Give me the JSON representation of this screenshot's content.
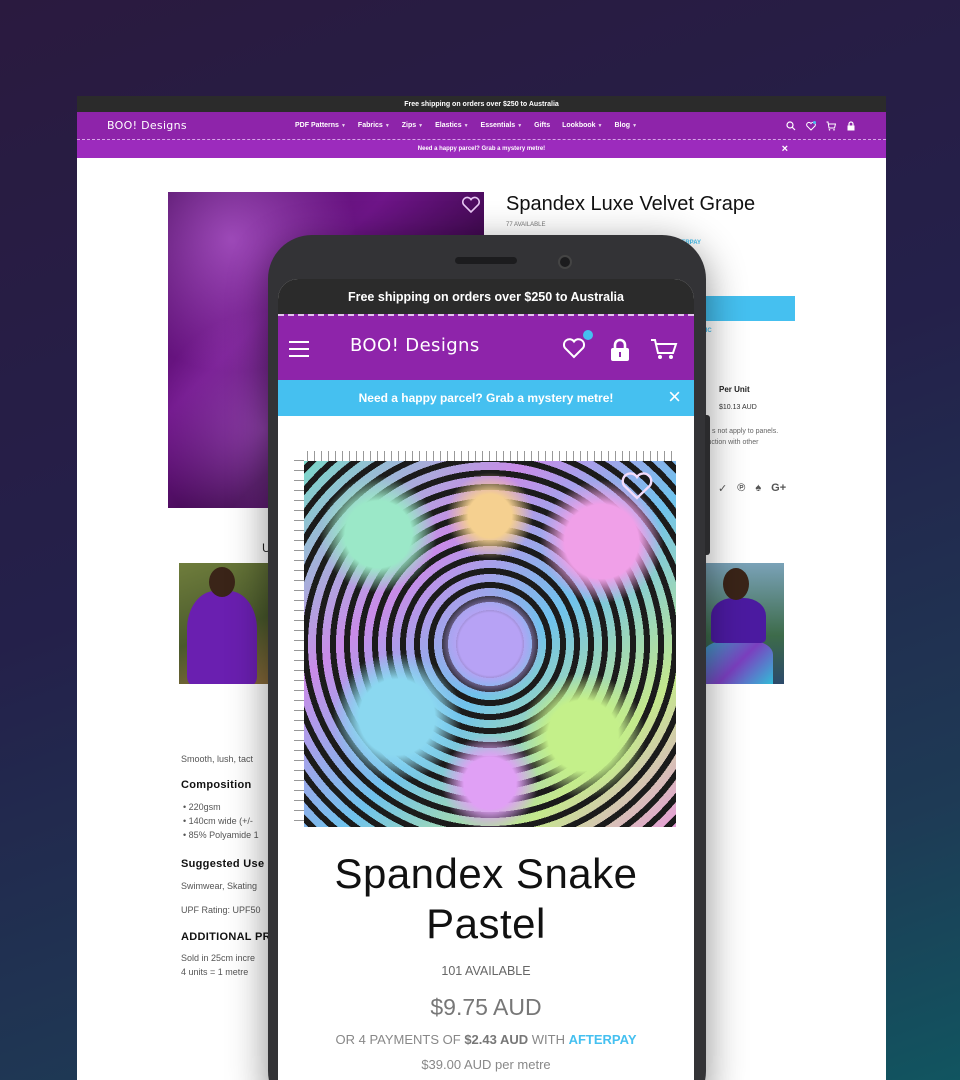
{
  "desktop": {
    "shipping_banner": "Free shipping on orders over $250 to Australia",
    "logo": "BOO! Designs",
    "menu": [
      {
        "label": "PDF Patterns",
        "chevron": true
      },
      {
        "label": "Fabrics",
        "chevron": true
      },
      {
        "label": "Zips",
        "chevron": true
      },
      {
        "label": "Elastics",
        "chevron": true
      },
      {
        "label": "Essentials",
        "chevron": true
      },
      {
        "label": "Gifts",
        "chevron": false
      },
      {
        "label": "Lookbook",
        "chevron": true
      },
      {
        "label": "Blog",
        "chevron": true
      }
    ],
    "promo": "Need a happy parcel? Grab a mystery metre!",
    "product": {
      "title": "Spandex Luxe Velvet Grape",
      "available": "77 AVAILABLE",
      "afterpay_link": "FTERPAY",
      "fabric_link": "BRIC",
      "per_unit_heading": "Per Unit",
      "per_unit_value": "$10.13 AUD",
      "note_line1": "s not apply to panels.",
      "note_line2": "njuction with other",
      "share_icons": [
        "twitter-icon",
        "pinterest-icon",
        "fancy-icon",
        "google-plus-icon"
      ]
    },
    "u_heading": "U",
    "description": {
      "intro": "Smooth, lush, tact",
      "composition_heading": "Composition",
      "composition_items": [
        "• 220gsm",
        "• 140cm wide (+/-",
        "• 85% Polyamide 1"
      ],
      "suggested_heading": "Suggested Use",
      "suggested_text": "Swimwear, Skating",
      "upf": "UPF Rating: UPF50",
      "additional_heading": "ADDITIONAL PR",
      "sold_line1": "Sold in 25cm incre",
      "sold_line2": "4 units = 1 metre"
    }
  },
  "mobile": {
    "shipping_banner": "Free shipping on orders over $250 to Australia",
    "logo": "BOO! Designs",
    "promo": "Need a happy parcel? Grab a mystery metre!",
    "product": {
      "title_line1": "Spandex Snake",
      "title_line2": "Pastel",
      "available": "101 AVAILABLE",
      "price": "$9.75 AUD",
      "afterpay_prefix": "OR 4 PAYMENTS OF ",
      "afterpay_amount": "$2.43 AUD",
      "afterpay_with": " WITH ",
      "afterpay_brand": "AFTERPAY",
      "per_metre": "$39.00 AUD per metre"
    }
  },
  "colors": {
    "brand_purple": "#8e24aa",
    "accent_blue": "#45c0f0",
    "topbar_dark": "#2b2b2b"
  }
}
